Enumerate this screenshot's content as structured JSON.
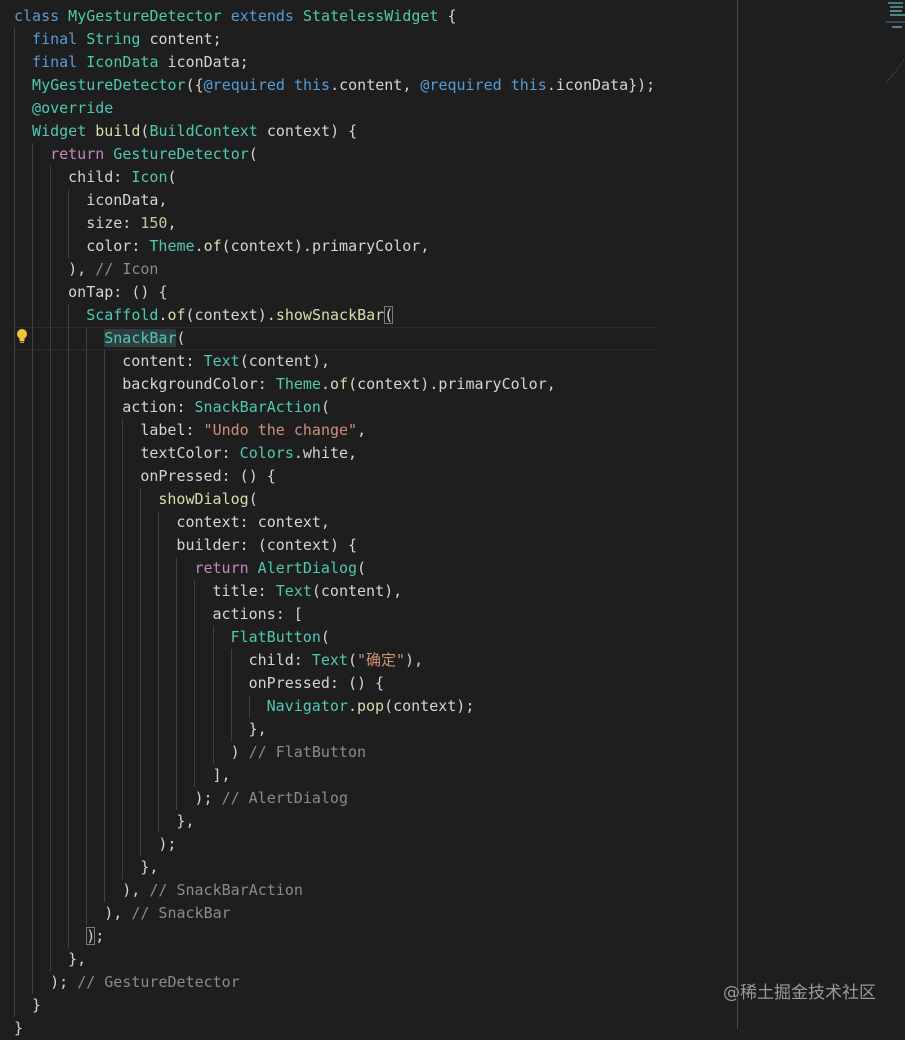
{
  "editor": {
    "colors": {
      "keyword": "#569cd6",
      "type": "#4ec9b0",
      "function": "#dcdcaa",
      "control": "#c586c0",
      "string": "#ce9178",
      "number": "#b5cea8",
      "comment": "#8b8b8b",
      "text": "#d4d4d4",
      "background": "#1e1e1e"
    },
    "lightbulb_line": 15,
    "lines": [
      {
        "i": 0,
        "t": [
          [
            "k",
            "class"
          ],
          [
            "t",
            " MyGestureDetector "
          ],
          [
            "k",
            "extends"
          ],
          [
            "t",
            " StatelessWidget"
          ],
          [
            "",
            " {"
          ]
        ]
      },
      {
        "i": 1,
        "t": [
          [
            "k",
            "final"
          ],
          [
            "t",
            " String"
          ],
          [
            "",
            " content;"
          ]
        ]
      },
      {
        "i": 1,
        "t": [
          [
            "k",
            "final"
          ],
          [
            "t",
            " IconData"
          ],
          [
            "",
            " iconData;"
          ]
        ]
      },
      {
        "i": 1,
        "t": [
          [
            "t",
            "MyGestureDetector"
          ],
          [
            "",
            "({"
          ],
          [
            "k",
            "@required"
          ],
          [
            "k",
            " this"
          ],
          [
            "",
            ".content, "
          ],
          [
            "k",
            "@required"
          ],
          [
            "k",
            " this"
          ],
          [
            "",
            ".iconData});"
          ]
        ]
      },
      {
        "i": 1,
        "t": [
          [
            "t",
            "@override"
          ]
        ]
      },
      {
        "i": 1,
        "t": [
          [
            "t",
            "Widget"
          ],
          [
            "f",
            " build"
          ],
          [
            "",
            "("
          ],
          [
            "t",
            "BuildContext"
          ],
          [
            "",
            " context) {"
          ]
        ]
      },
      {
        "i": 2,
        "t": [
          [
            "p",
            "return"
          ],
          [
            "t",
            " GestureDetector"
          ],
          [
            "",
            "("
          ]
        ]
      },
      {
        "i": 3,
        "t": [
          [
            "",
            "child: "
          ],
          [
            "t",
            "Icon"
          ],
          [
            "",
            "("
          ]
        ]
      },
      {
        "i": 4,
        "t": [
          [
            "",
            "iconData,"
          ]
        ]
      },
      {
        "i": 4,
        "t": [
          [
            "",
            "size: "
          ],
          [
            "n",
            "150"
          ],
          [
            "",
            ","
          ]
        ]
      },
      {
        "i": 4,
        "t": [
          [
            "",
            "color: "
          ],
          [
            "t",
            "Theme"
          ],
          [
            "",
            "."
          ],
          [
            "f",
            "of"
          ],
          [
            "",
            "(context).primaryColor,"
          ]
        ]
      },
      {
        "i": 3,
        "t": [
          [
            "",
            "), "
          ],
          [
            "c",
            "// Icon"
          ]
        ]
      },
      {
        "i": 3,
        "t": [
          [
            "",
            "onTap: () {"
          ]
        ]
      },
      {
        "i": 4,
        "t": [
          [
            "t",
            "Scaffold"
          ],
          [
            "",
            "."
          ],
          [
            "f",
            "of"
          ],
          [
            "",
            "(context)."
          ],
          [
            "f",
            "showSnackBar"
          ],
          [
            "bm",
            "("
          ]
        ]
      },
      {
        "i": 5,
        "t": [
          [
            "t hl",
            "SnackBar"
          ],
          [
            "",
            "("
          ]
        ]
      },
      {
        "i": 6,
        "t": [
          [
            "",
            "content: "
          ],
          [
            "t",
            "Text"
          ],
          [
            "",
            "(content),"
          ]
        ]
      },
      {
        "i": 6,
        "t": [
          [
            "",
            "backgroundColor: "
          ],
          [
            "t",
            "Theme"
          ],
          [
            "",
            "."
          ],
          [
            "f",
            "of"
          ],
          [
            "",
            "(context).primaryColor,"
          ]
        ]
      },
      {
        "i": 6,
        "t": [
          [
            "",
            "action: "
          ],
          [
            "t",
            "SnackBarAction"
          ],
          [
            "",
            "("
          ]
        ]
      },
      {
        "i": 7,
        "t": [
          [
            "",
            "label: "
          ],
          [
            "s",
            "\"Undo the change\""
          ],
          [
            "",
            ","
          ]
        ]
      },
      {
        "i": 7,
        "t": [
          [
            "",
            "textColor: "
          ],
          [
            "t",
            "Colors"
          ],
          [
            "",
            ".white,"
          ]
        ]
      },
      {
        "i": 7,
        "t": [
          [
            "",
            "onPressed: () {"
          ]
        ]
      },
      {
        "i": 8,
        "t": [
          [
            "f",
            "showDialog"
          ],
          [
            "",
            "("
          ]
        ]
      },
      {
        "i": 9,
        "t": [
          [
            "",
            "context: context,"
          ]
        ]
      },
      {
        "i": 9,
        "t": [
          [
            "",
            "builder: (context) {"
          ]
        ]
      },
      {
        "i": 10,
        "t": [
          [
            "p",
            "return"
          ],
          [
            "t",
            " AlertDialog"
          ],
          [
            "",
            "("
          ]
        ]
      },
      {
        "i": 11,
        "t": [
          [
            "",
            "title: "
          ],
          [
            "t",
            "Text"
          ],
          [
            "",
            "(content),"
          ]
        ]
      },
      {
        "i": 11,
        "t": [
          [
            "",
            "actions: ["
          ]
        ]
      },
      {
        "i": 12,
        "t": [
          [
            "t",
            "FlatButton"
          ],
          [
            "",
            "("
          ]
        ]
      },
      {
        "i": 13,
        "t": [
          [
            "",
            "child: "
          ],
          [
            "t",
            "Text"
          ],
          [
            "",
            "("
          ],
          [
            "s",
            "\"确定\""
          ],
          [
            "",
            "),"
          ]
        ]
      },
      {
        "i": 13,
        "t": [
          [
            "",
            "onPressed: () {"
          ]
        ]
      },
      {
        "i": 14,
        "t": [
          [
            "t",
            "Navigator"
          ],
          [
            "",
            "."
          ],
          [
            "f",
            "pop"
          ],
          [
            "",
            "(context);"
          ]
        ]
      },
      {
        "i": 13,
        "t": [
          [
            "",
            "},"
          ]
        ]
      },
      {
        "i": 12,
        "t": [
          [
            "",
            ") "
          ],
          [
            "c",
            "// FlatButton"
          ]
        ]
      },
      {
        "i": 11,
        "t": [
          [
            "",
            "],"
          ]
        ]
      },
      {
        "i": 10,
        "t": [
          [
            "",
            "); "
          ],
          [
            "c",
            "// AlertDialog"
          ]
        ]
      },
      {
        "i": 9,
        "t": [
          [
            "",
            "},"
          ]
        ]
      },
      {
        "i": 8,
        "t": [
          [
            "",
            ");"
          ]
        ]
      },
      {
        "i": 7,
        "t": [
          [
            "",
            "},"
          ]
        ]
      },
      {
        "i": 6,
        "t": [
          [
            "",
            "), "
          ],
          [
            "c",
            "// SnackBarAction"
          ]
        ]
      },
      {
        "i": 5,
        "t": [
          [
            "",
            "), "
          ],
          [
            "c",
            "// SnackBar"
          ]
        ]
      },
      {
        "i": 4,
        "t": [
          [
            "bm",
            ")"
          ],
          [
            "",
            ";"
          ]
        ]
      },
      {
        "i": 3,
        "t": [
          [
            "",
            "},"
          ]
        ]
      },
      {
        "i": 2,
        "t": [
          [
            "",
            "); "
          ],
          [
            "c",
            "// GestureDetector"
          ]
        ]
      },
      {
        "i": 1,
        "t": [
          [
            "",
            "}"
          ]
        ]
      },
      {
        "i": 0,
        "t": [
          [
            "",
            "}"
          ]
        ]
      }
    ]
  },
  "watermark": "@稀土掘金技术社区"
}
